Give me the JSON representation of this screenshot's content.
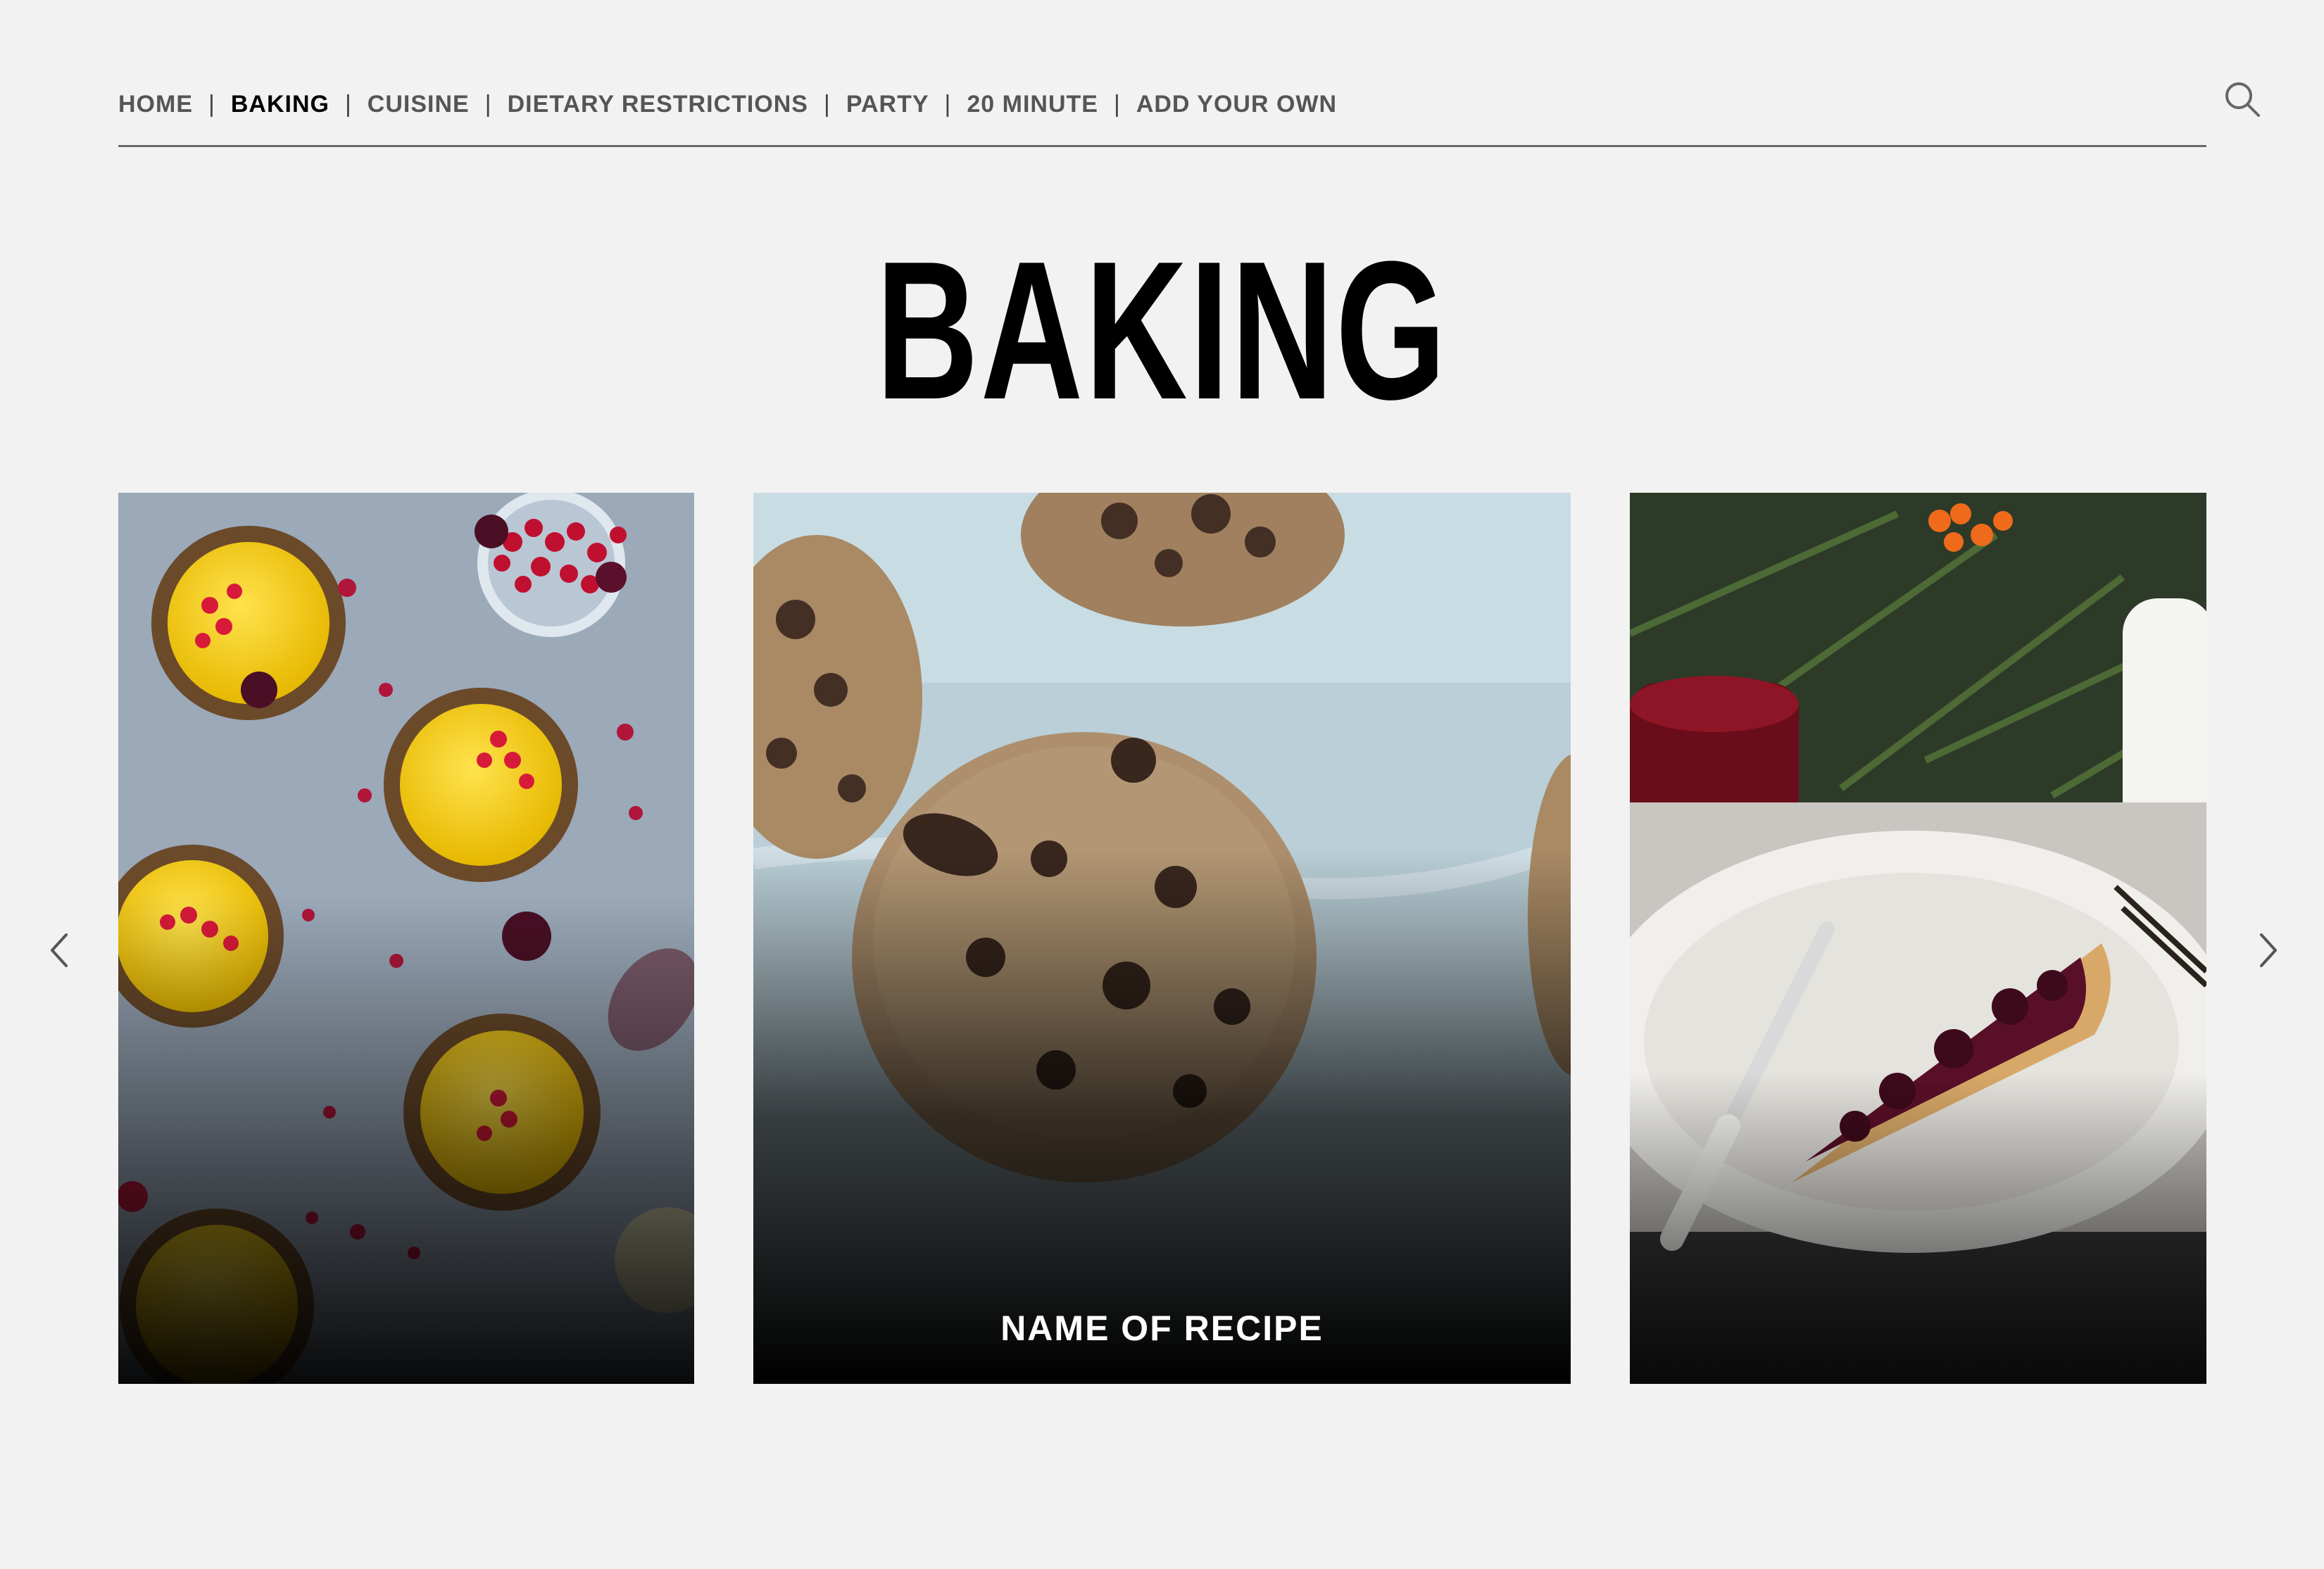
{
  "nav": {
    "items": [
      {
        "label": "HOME",
        "active": false
      },
      {
        "label": "BAKING",
        "active": true
      },
      {
        "label": "CUISINE",
        "active": false
      },
      {
        "label": "DIETARY RESTRICTIONS",
        "active": false
      },
      {
        "label": "PARTY",
        "active": false
      },
      {
        "label": "20 MINUTE",
        "active": false
      },
      {
        "label": "ADD YOUR OWN",
        "active": false
      }
    ],
    "separator": "|",
    "search_icon": "search-icon"
  },
  "page": {
    "title": "BAKING"
  },
  "carousel": {
    "prev_icon": "chevron-left-icon",
    "next_icon": "chevron-right-icon",
    "cards": [
      {
        "image": "lemon-curd-tarts-with-red-currants",
        "name": ""
      },
      {
        "image": "chocolate-chunk-cookies",
        "name": "NAME OF RECIPE"
      },
      {
        "image": "cherry-pie-slice",
        "name": ""
      }
    ]
  },
  "colors": {
    "background": "#f2f2f2",
    "nav_text": "#555555",
    "nav_active": "#000000",
    "rule": "#6a6a6a",
    "title": "#000000",
    "caption": "#ffffff"
  }
}
